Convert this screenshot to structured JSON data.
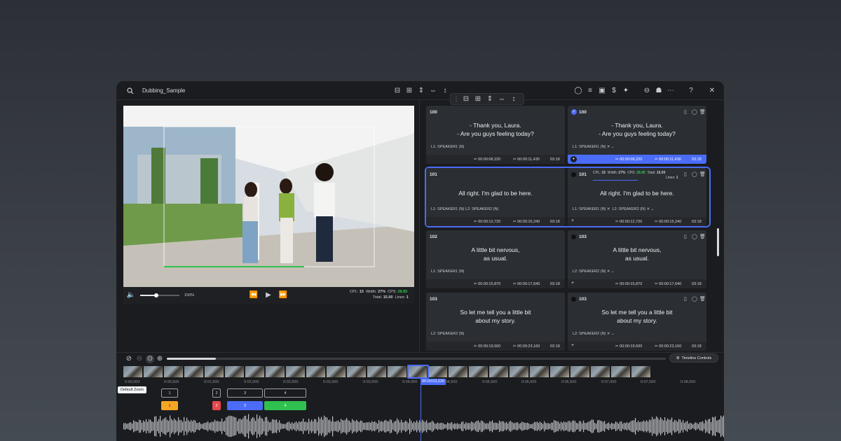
{
  "app": {
    "project_title": "Dubbing_Sample"
  },
  "player": {
    "zoom": "150%",
    "cpl_label": "CPL:",
    "cpl": "15",
    "width_label": "Width:",
    "width": "27%",
    "cps_label": "CPS:",
    "cps": "28.85",
    "total_label": "Total:",
    "total": "15.00",
    "lines_label": "Lines:",
    "lines": "1"
  },
  "cards": [
    {
      "left": {
        "id": "100",
        "text1": "- Thank you, Laura.",
        "text2": "- Are you guys feeling today?",
        "speakers": "L1: SPEAKER1 (N)",
        "start": "00:00:08,220",
        "end": "00:00:11,430",
        "dur": "03:18"
      },
      "right": {
        "id": "100",
        "text1": "- Thank you, Laura.",
        "text2": "- Are you guys feeling today?",
        "speakers": "L1: SPEAKER1 (N)",
        "start": "00:00:08,220",
        "end": "00:00:11,430",
        "dur": "03:18"
      }
    },
    {
      "left": {
        "id": "101",
        "text1": "All right. I'm glad to be here.",
        "text2": "",
        "speakers": "L1: SPEAKER1 (N)   L2: SPEAKER2 (N)",
        "start": "00:00:12,720",
        "end": "00:00:15,240",
        "dur": "03:18"
      },
      "right": {
        "id": "101",
        "text1": "All right. I'm glad to be here.",
        "text2": "",
        "speakers": "L1: SPEAKER1 (N)",
        "speakers2": "L2: SPEAKER2 (N)",
        "start": "00:00:12,720",
        "end": "00:00:15,240",
        "dur": "03:18",
        "cpl_label": "CPL:",
        "cpl": "15",
        "width_label": "Width:",
        "width": "27%",
        "cps_label": "CPS:",
        "cps": "28.85",
        "total_label": "Total:",
        "total": "15.00",
        "lines_label": "Lines:",
        "lines": "1"
      }
    },
    {
      "left": {
        "id": "102",
        "text1": "A little bit nervous,",
        "text2": "as usual.",
        "speakers": "L1: SPEAKER1 (N)",
        "start": "00:00:15,870",
        "end": "00:00:17,640",
        "dur": "03:18"
      },
      "right": {
        "id": "103",
        "text1": "A little bit nervous,",
        "text2": "as usual.",
        "speakers": "L2: SPEAKER2 (N)",
        "start": "00:00:15,870",
        "end": "00:00:17,640",
        "dur": "03:18"
      }
    },
    {
      "left": {
        "id": "103",
        "text1": "So let me tell you a little bit",
        "text2": "about my story.",
        "speakers": "L2: SPEAKER2 (N)",
        "start": "00:00:19,500",
        "end": "00:00:23,160",
        "dur": "03:18"
      },
      "right": {
        "id": "103",
        "text1": "So let me tell you a little bit",
        "text2": "about my story.",
        "speakers": "L2: SPEAKER2 (N)",
        "start": "00:00:19,500",
        "end": "00:00:23,160",
        "dur": "03:18"
      }
    }
  ],
  "timeline": {
    "controls_label": "Timeline Controls",
    "tooltip": "Default Zoom",
    "playhead": "00:00:03,220",
    "ticks": [
      "0:00,000",
      "0:00,500",
      "0:01,500",
      "0:02,000",
      "0:02,500",
      "0:03,000",
      "0:03,500",
      "0:04,000",
      "0:04,500",
      "0:05,500",
      "0:06,000",
      "0:06,500",
      "0:07,000",
      "0:07,500",
      "0:08,000"
    ],
    "track1": [
      "1",
      "2",
      "3",
      "4"
    ],
    "track2": [
      "1",
      "2",
      "3",
      "4"
    ],
    "track2_colors": [
      "#f5a623",
      "#e5484d",
      "#4a6cf7",
      "#30c04f"
    ]
  }
}
